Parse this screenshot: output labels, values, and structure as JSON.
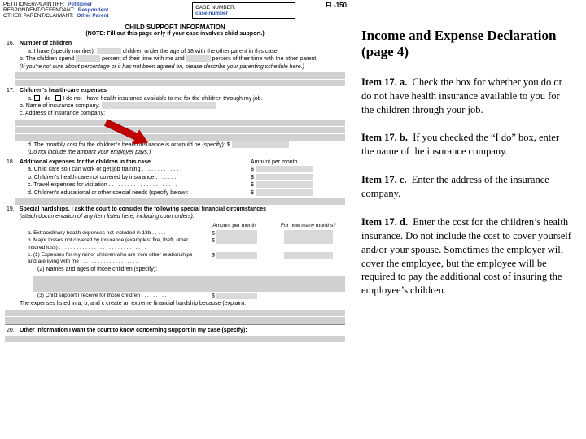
{
  "form": {
    "code": "FL-150",
    "header": {
      "petitioner_label": "PETITIONER/PLAINTIFF:",
      "petitioner_value": "Petitioner",
      "respondent_label": "RESPONDENT/DEFENDANT:",
      "respondent_value": "Respondent",
      "other_label": "OTHER PARENT/CLAIMANT:",
      "other_value": "Other Parent",
      "case_label": "CASE NUMBER:",
      "case_value": "case number"
    },
    "title": "CHILD SUPPORT INFORMATION",
    "note": "(NOTE: Fill out this page only if your case involves child support.)",
    "q16": {
      "num": "16.",
      "title": "Number of children",
      "a": "a.  I have (specify number):",
      "a_tail": "children under the age of 18 with the other parent in this case.",
      "b": "b.  The children spend",
      "b_tail": "percent of their time with me and",
      "b_tail2": "percent of their time with the other parent.",
      "b_note": "(If you're not sure about percentage or it has not been agreed on, please describe your parenting schedule here.)"
    },
    "q17": {
      "num": "17.",
      "title": "Children's health-care expenses",
      "a": "a.",
      "a_do": "I do",
      "a_donot": "I do not",
      "a_tail": "have health insurance available to me for the children through my job.",
      "b": "b.  Name of insurance company:",
      "c": "c.  Address of insurance company:",
      "d": "d.  The monthly cost for the children's health insurance is or would be (specify):   $",
      "d_note": "(Do not include the amount your employer pays.)"
    },
    "q18": {
      "num": "18.",
      "title": "Additional expenses for the children in this case",
      "col": "Amount per month",
      "a": "a.  Child care so I can work or get job training . . . . . . . . . . . .",
      "b": "b.  Children's health care not covered by insurance  . . . . . . .",
      "c": "c.  Travel expenses for visitation  . . . . . . . . . . . . . . . . . . . . . .",
      "d": "d.  Children's educational or other special needs (specify below):"
    },
    "q19": {
      "num": "19.",
      "title": "Special hardships.  I ask the court to consider the following special financial circumstances",
      "sub": "(attach documentation of any item listed here, including court orders):",
      "col1": "Amount per month",
      "col2": "For how many months?",
      "a": "a.  Extraordinary health expenses not included in 18b  . . . . .",
      "b": "b.  Major losses not covered by insurance (examples: fire, theft, other insured loss)  . . . . . . . . . . . . . . . . . . . . . . . . . . . . . .",
      "c1": "c.  (1) Expenses for my minor children who are from other relationships and are living with me  . . . . . . . . . . . . . . . . . . . .",
      "c2": "(2) Names and ages of those children (specify):",
      "c3": "(3) Child support I receive for those children  . . . . . . . . .",
      "tail": "The expenses listed in a, b, and c create an extreme financial hardship because (explain):"
    },
    "q20": {
      "num": "20.",
      "title": "Other information I want the court to know concerning support in my case (specify):"
    }
  },
  "notes": {
    "title": "Income and Expense Declaration (page 4)",
    "i17a_label": "Item 17. a.",
    "i17a": "Check the box for whether you do or do not have health insurance available to you for the children through your job.",
    "i17b_label": "Item 17. b.",
    "i17b": "If you checked the “I do” box, enter the name of the insurance company.",
    "i17c_label": "Item 17. c.",
    "i17c": "Enter the address of the insurance company.",
    "i17d_label": "Item 17. d.",
    "i17d": "Enter the cost for the children’s health insurance.  Do not include the cost to cover yourself and/or your spouse.  Sometimes the employer will cover the employee, but the employee will be required to pay the additional cost of insuring the employee’s children."
  }
}
